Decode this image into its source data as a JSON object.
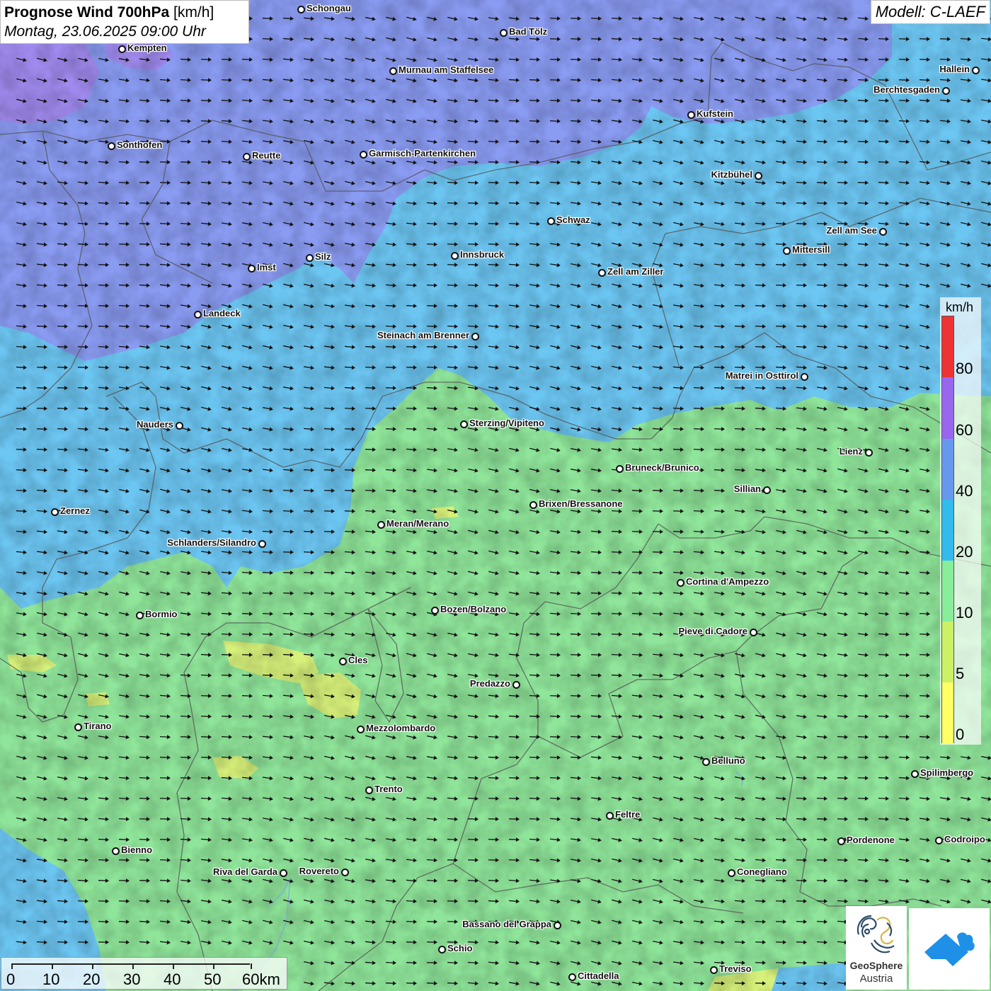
{
  "header": {
    "title_bold": "Prognose Wind 700hPa",
    "title_unit": "[km/h]",
    "datetime": "Montag, 23.06.2025 09:00 Uhr",
    "model": "Modell: C-LAEF"
  },
  "legend": {
    "unit": "km/h",
    "ticks": [
      "80",
      "60",
      "40",
      "20",
      "10",
      "5",
      "0"
    ],
    "colors": [
      "#ee3333",
      "#9966ee",
      "#6699ee",
      "#33bbee",
      "#88ee99",
      "#ccf066",
      "#ffff66"
    ]
  },
  "scalebar": {
    "labels": [
      "0",
      "10",
      "20",
      "30",
      "40",
      "50",
      "60km"
    ]
  },
  "branding": {
    "geosphere_line1": "GeoSphere",
    "geosphere_line2": "Austria"
  },
  "colors": {
    "violet": "#9c8cf0",
    "periwinkle": "#8a9bf2",
    "light_blue": "#6cc6f2",
    "cyan": "#4fb8ec",
    "green": "#8fe59a",
    "yellow_green": "#d6f07a"
  },
  "cities": [
    {
      "name": "Schongau"
    },
    {
      "name": "Bad Tölz"
    },
    {
      "name": "Kempten"
    },
    {
      "name": "Murnau am Staffelsee"
    },
    {
      "name": "Hallein"
    },
    {
      "name": "Berchtesgaden"
    },
    {
      "name": "Kufstein"
    },
    {
      "name": "Sonthofen"
    },
    {
      "name": "Reutte"
    },
    {
      "name": "Garmisch-Partenkirchen"
    },
    {
      "name": "Kitzbühel"
    },
    {
      "name": "Schwaz"
    },
    {
      "name": "Zell am See"
    },
    {
      "name": "Mittersill"
    },
    {
      "name": "Innsbruck"
    },
    {
      "name": "Silz"
    },
    {
      "name": "Imst"
    },
    {
      "name": "Zell am Ziller"
    },
    {
      "name": "Landeck"
    },
    {
      "name": "Steinach am Brenner"
    },
    {
      "name": "Matrei in Osttirol"
    },
    {
      "name": "Nauders"
    },
    {
      "name": "Sterzing/Vipiteno"
    },
    {
      "name": "Lienz"
    },
    {
      "name": "Bruneck/Brunico"
    },
    {
      "name": "Sillian"
    },
    {
      "name": "Zernez"
    },
    {
      "name": "Brixen/Bressanone"
    },
    {
      "name": "Meran/Merano"
    },
    {
      "name": "Schlanders/Silandro"
    },
    {
      "name": "Cortina d'Ampezzo"
    },
    {
      "name": "Bozen/Bolzano"
    },
    {
      "name": "Bormio"
    },
    {
      "name": "Pieve di Cadore"
    },
    {
      "name": "Cles"
    },
    {
      "name": "Predazzo"
    },
    {
      "name": "Tirano"
    },
    {
      "name": "Mezzolombardo"
    },
    {
      "name": "Belluno"
    },
    {
      "name": "Spilimbergo"
    },
    {
      "name": "Trento"
    },
    {
      "name": "Feltre"
    },
    {
      "name": "Pordenone"
    },
    {
      "name": "Codroipo"
    },
    {
      "name": "Bienno"
    },
    {
      "name": "Riva del Garda"
    },
    {
      "name": "Rovereto"
    },
    {
      "name": "Conegliano"
    },
    {
      "name": "Bassano del Grappa"
    },
    {
      "name": "Schio"
    },
    {
      "name": "Treviso"
    },
    {
      "name": "Cittadella"
    }
  ]
}
